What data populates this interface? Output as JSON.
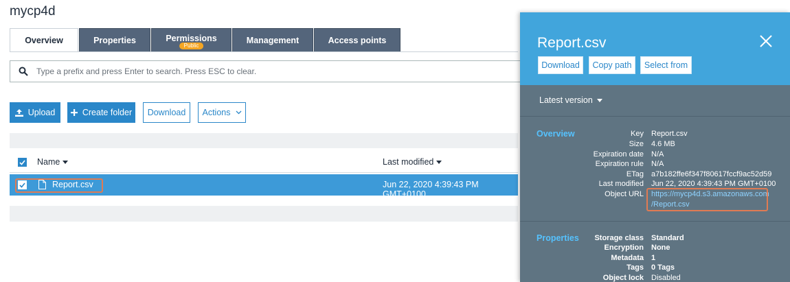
{
  "bucket": {
    "name": "mycp4d"
  },
  "tabs": [
    {
      "label": "Overview",
      "active": true
    },
    {
      "label": "Properties"
    },
    {
      "label": "Permissions",
      "badge": "Public"
    },
    {
      "label": "Management"
    },
    {
      "label": "Access points"
    }
  ],
  "search": {
    "placeholder": "Type a prefix and press Enter to search. Press ESC to clear."
  },
  "toolbar": {
    "upload": "Upload",
    "create_folder": "Create folder",
    "download": "Download",
    "actions": "Actions"
  },
  "table": {
    "columns": {
      "name": "Name",
      "last_modified": "Last modified"
    },
    "rows": [
      {
        "name": "Report.csv",
        "last_modified": "Jun 22, 2020 4:39:43 PM GMT+0100",
        "selected": true
      }
    ]
  },
  "panel": {
    "title": "Report.csv",
    "buttons": {
      "download": "Download",
      "copy_path": "Copy path",
      "select_from": "Select from"
    },
    "version": "Latest version",
    "overview": {
      "label": "Overview",
      "fields": [
        {
          "key": "Key",
          "value": "Report.csv"
        },
        {
          "key": "Size",
          "value": "4.6 MB"
        },
        {
          "key": "Expiration date",
          "value": "N/A"
        },
        {
          "key": "Expiration rule",
          "value": "N/A"
        },
        {
          "key": "ETag",
          "value": "a7b182ffe6f347f80617fccf9ac52d59"
        },
        {
          "key": "Last modified",
          "value": "Jun 22, 2020 4:39:43 PM GMT+0100"
        }
      ],
      "object_url": {
        "key": "Object URL",
        "line1": "https://mycp4d.s3.amazonaws.com",
        "line2": "/Report.csv"
      }
    },
    "properties": {
      "label": "Properties",
      "fields": [
        {
          "key": "Storage class",
          "value": "Standard"
        },
        {
          "key": "Encryption",
          "value": "None"
        },
        {
          "key": "Metadata",
          "value": "1"
        },
        {
          "key": "Tags",
          "value": "0 Tags"
        },
        {
          "key": "Object lock",
          "value": "Disabled"
        }
      ]
    }
  },
  "colors": {
    "accent": "#2a87c9",
    "selected_row": "#3d9ad8",
    "panel_header": "#41a5dc",
    "panel_body": "#5f7482",
    "highlight": "#e07b53",
    "badge": "#f5a623"
  }
}
